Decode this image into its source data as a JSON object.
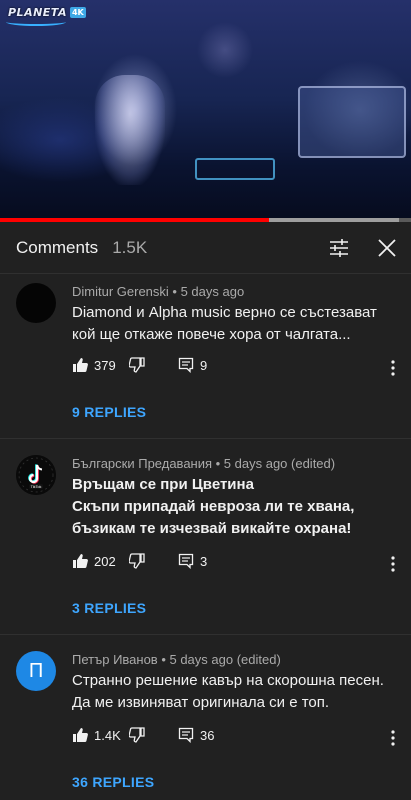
{
  "video": {
    "logo_text": "PLANETA",
    "logo_badge": "4K",
    "progress": {
      "played": 0.655,
      "buffered": 0.97
    }
  },
  "header": {
    "title": "Comments",
    "count": "1.5K",
    "sort_icon": "sort-filter-icon",
    "close_icon": "close-icon"
  },
  "comments": [
    {
      "author_meta": "Dimitur Gerenski • 5 days ago",
      "lines": [
        "Diamond и Alpha music верно се състезават",
        "кой ще откаже повече хора от чалгата..."
      ],
      "likes": "379",
      "replies_count": "9",
      "view_replies": "9 REPLIES",
      "avatar": "dark"
    },
    {
      "author_meta": "Български Предавания • 5 days ago (edited)",
      "lines": [
        "Връщам се при Цветина",
        "Скъпи припадай невроза ли те хвана,",
        "бъзикам те изчезвай викайте охрана!"
      ],
      "likes": "202",
      "replies_count": "3",
      "view_replies": "3 REPLIES",
      "avatar": "tiktok",
      "avatar_caption": "TikTok"
    },
    {
      "author_meta": "Петър Иванов • 5 days ago (edited)",
      "lines": [
        "Странно решение кавър на скорошна песен.",
        "Да ме извиняват оригинала си е топ."
      ],
      "likes": "1.4K",
      "replies_count": "36",
      "view_replies": "36 REPLIES",
      "avatar": "letter",
      "avatar_letter": "П",
      "avatar_color": "#1e88e5"
    }
  ],
  "colors": {
    "accent_link": "#3ea6ff",
    "progress_red": "#ff0000",
    "panel_bg": "#212121"
  }
}
